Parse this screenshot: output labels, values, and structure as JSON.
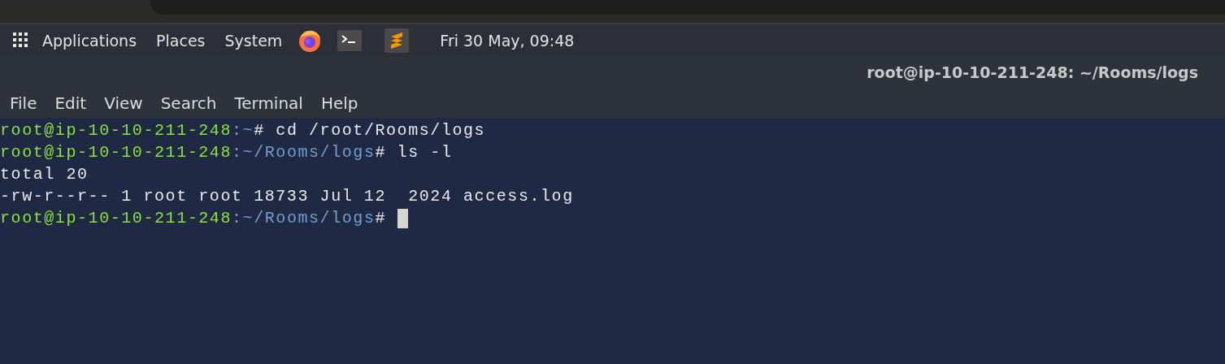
{
  "panel": {
    "menus": [
      "Applications",
      "Places",
      "System"
    ],
    "launchers": [
      {
        "kind": "firefox"
      },
      {
        "kind": "terminal"
      },
      {
        "kind": "sublime"
      }
    ],
    "clock": "Fri 30 May, 09:48"
  },
  "terminal": {
    "title": "root@ip-10-10-211-248: ~/Rooms/logs",
    "menu": [
      "File",
      "Edit",
      "View",
      "Search",
      "Terminal",
      "Help"
    ],
    "lines": [
      {
        "segments": [
          {
            "kind": "user",
            "text": "root@ip-10-10-211-248"
          },
          {
            "kind": "path",
            "text": ":~"
          },
          {
            "kind": "plain",
            "text": "# cd /root/Rooms/logs"
          }
        ]
      },
      {
        "segments": [
          {
            "kind": "user",
            "text": "root@ip-10-10-211-248"
          },
          {
            "kind": "path",
            "text": ":~/Rooms/logs"
          },
          {
            "kind": "plain",
            "text": "# ls -l"
          }
        ]
      },
      {
        "segments": [
          {
            "kind": "plain",
            "text": "total 20"
          }
        ]
      },
      {
        "segments": [
          {
            "kind": "plain",
            "text": "-rw-r--r-- 1 root root 18733 Jul 12  2024 access.log"
          }
        ]
      },
      {
        "segments": [
          {
            "kind": "user",
            "text": "root@ip-10-10-211-248"
          },
          {
            "kind": "path",
            "text": ":~/Rooms/logs"
          },
          {
            "kind": "plain",
            "text": "# "
          }
        ],
        "cursor": true
      }
    ]
  }
}
